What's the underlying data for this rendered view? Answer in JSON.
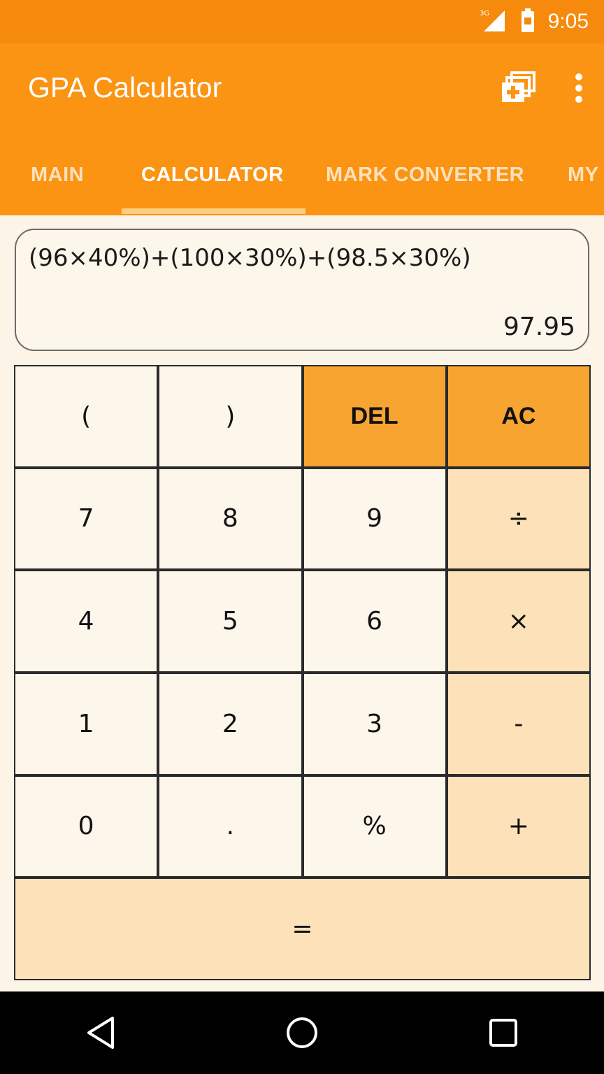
{
  "status_bar": {
    "time": "9:05",
    "network": "3G"
  },
  "app_bar": {
    "title": "GPA Calculator"
  },
  "tabs": [
    {
      "label": "MAIN",
      "active": false
    },
    {
      "label": "CALCULATOR",
      "active": true
    },
    {
      "label": "MARK CONVERTER",
      "active": false
    },
    {
      "label": "MY",
      "active": false
    }
  ],
  "display": {
    "expression": "(96×40%)+(100×30%)+(98.5×30%)",
    "result": "97.95"
  },
  "keypad": {
    "rows": [
      [
        "(",
        ")",
        "DEL",
        "AC"
      ],
      [
        "7",
        "8",
        "9",
        "÷"
      ],
      [
        "4",
        "5",
        "6",
        "×"
      ],
      [
        "1",
        "2",
        "3",
        "-"
      ],
      [
        "0",
        ".",
        "%",
        "+"
      ]
    ],
    "equals": "="
  },
  "colors": {
    "status_bar": "#f68a0c",
    "primary": "#fb9313",
    "accent_key": "#f7a431",
    "operator_key": "#fde1b8",
    "background": "#fcf4e6"
  }
}
